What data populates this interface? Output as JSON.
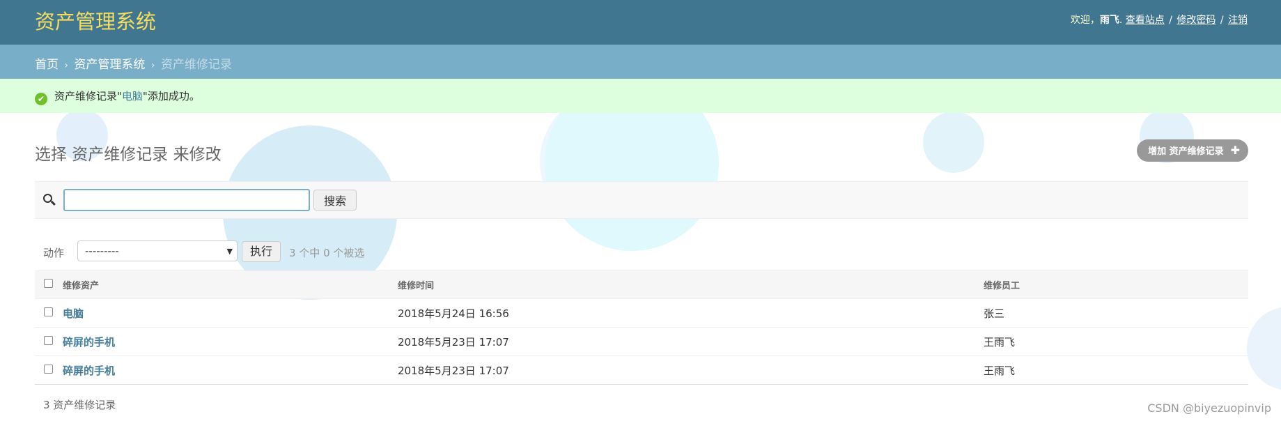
{
  "header": {
    "site_title": "资产管理系统",
    "welcome": "欢迎，",
    "username": "雨飞",
    "view_site": "查看站点",
    "change_password": "修改密码",
    "logout": "注销",
    "separator": "/"
  },
  "breadcrumbs": {
    "home": "首页",
    "app": "资产管理系统",
    "current": "资产维修记录",
    "separator": "›"
  },
  "message": {
    "prefix": "资产维修记录\"",
    "link": "电脑",
    "suffix": "\"添加成功。"
  },
  "main": {
    "page_title": "选择 资产维修记录 来修改",
    "add_button": "增加 资产维修记录",
    "search": {
      "value": "",
      "button": "搜索"
    },
    "actions": {
      "label": "动作",
      "selected": "---------",
      "go": "执行",
      "counter": "3 个中 0 个被选"
    },
    "table": {
      "headers": [
        "维修资产",
        "维修时间",
        "维修员工"
      ],
      "rows": [
        {
          "asset": "电脑",
          "time": "2018年5月24日 16:56",
          "staff": "张三"
        },
        {
          "asset": "碎屏的手机",
          "time": "2018年5月23日 17:07",
          "staff": "王雨飞"
        },
        {
          "asset": "碎屏的手机",
          "time": "2018年5月23日 17:07",
          "staff": "王雨飞"
        }
      ]
    },
    "paginator": "3 资产维修记录"
  },
  "watermark": "CSDN @biyezuopinvip",
  "colors": {
    "header_bg": "#417690",
    "title": "#f5dd5d",
    "breadcrumbs_bg": "#79aec8",
    "success_bg": "#dddfdd",
    "link": "#447e9b"
  },
  "icons": [
    "success-check-icon",
    "search-icon",
    "plus-icon",
    "caret-down-icon",
    "checkbox-icon"
  ]
}
